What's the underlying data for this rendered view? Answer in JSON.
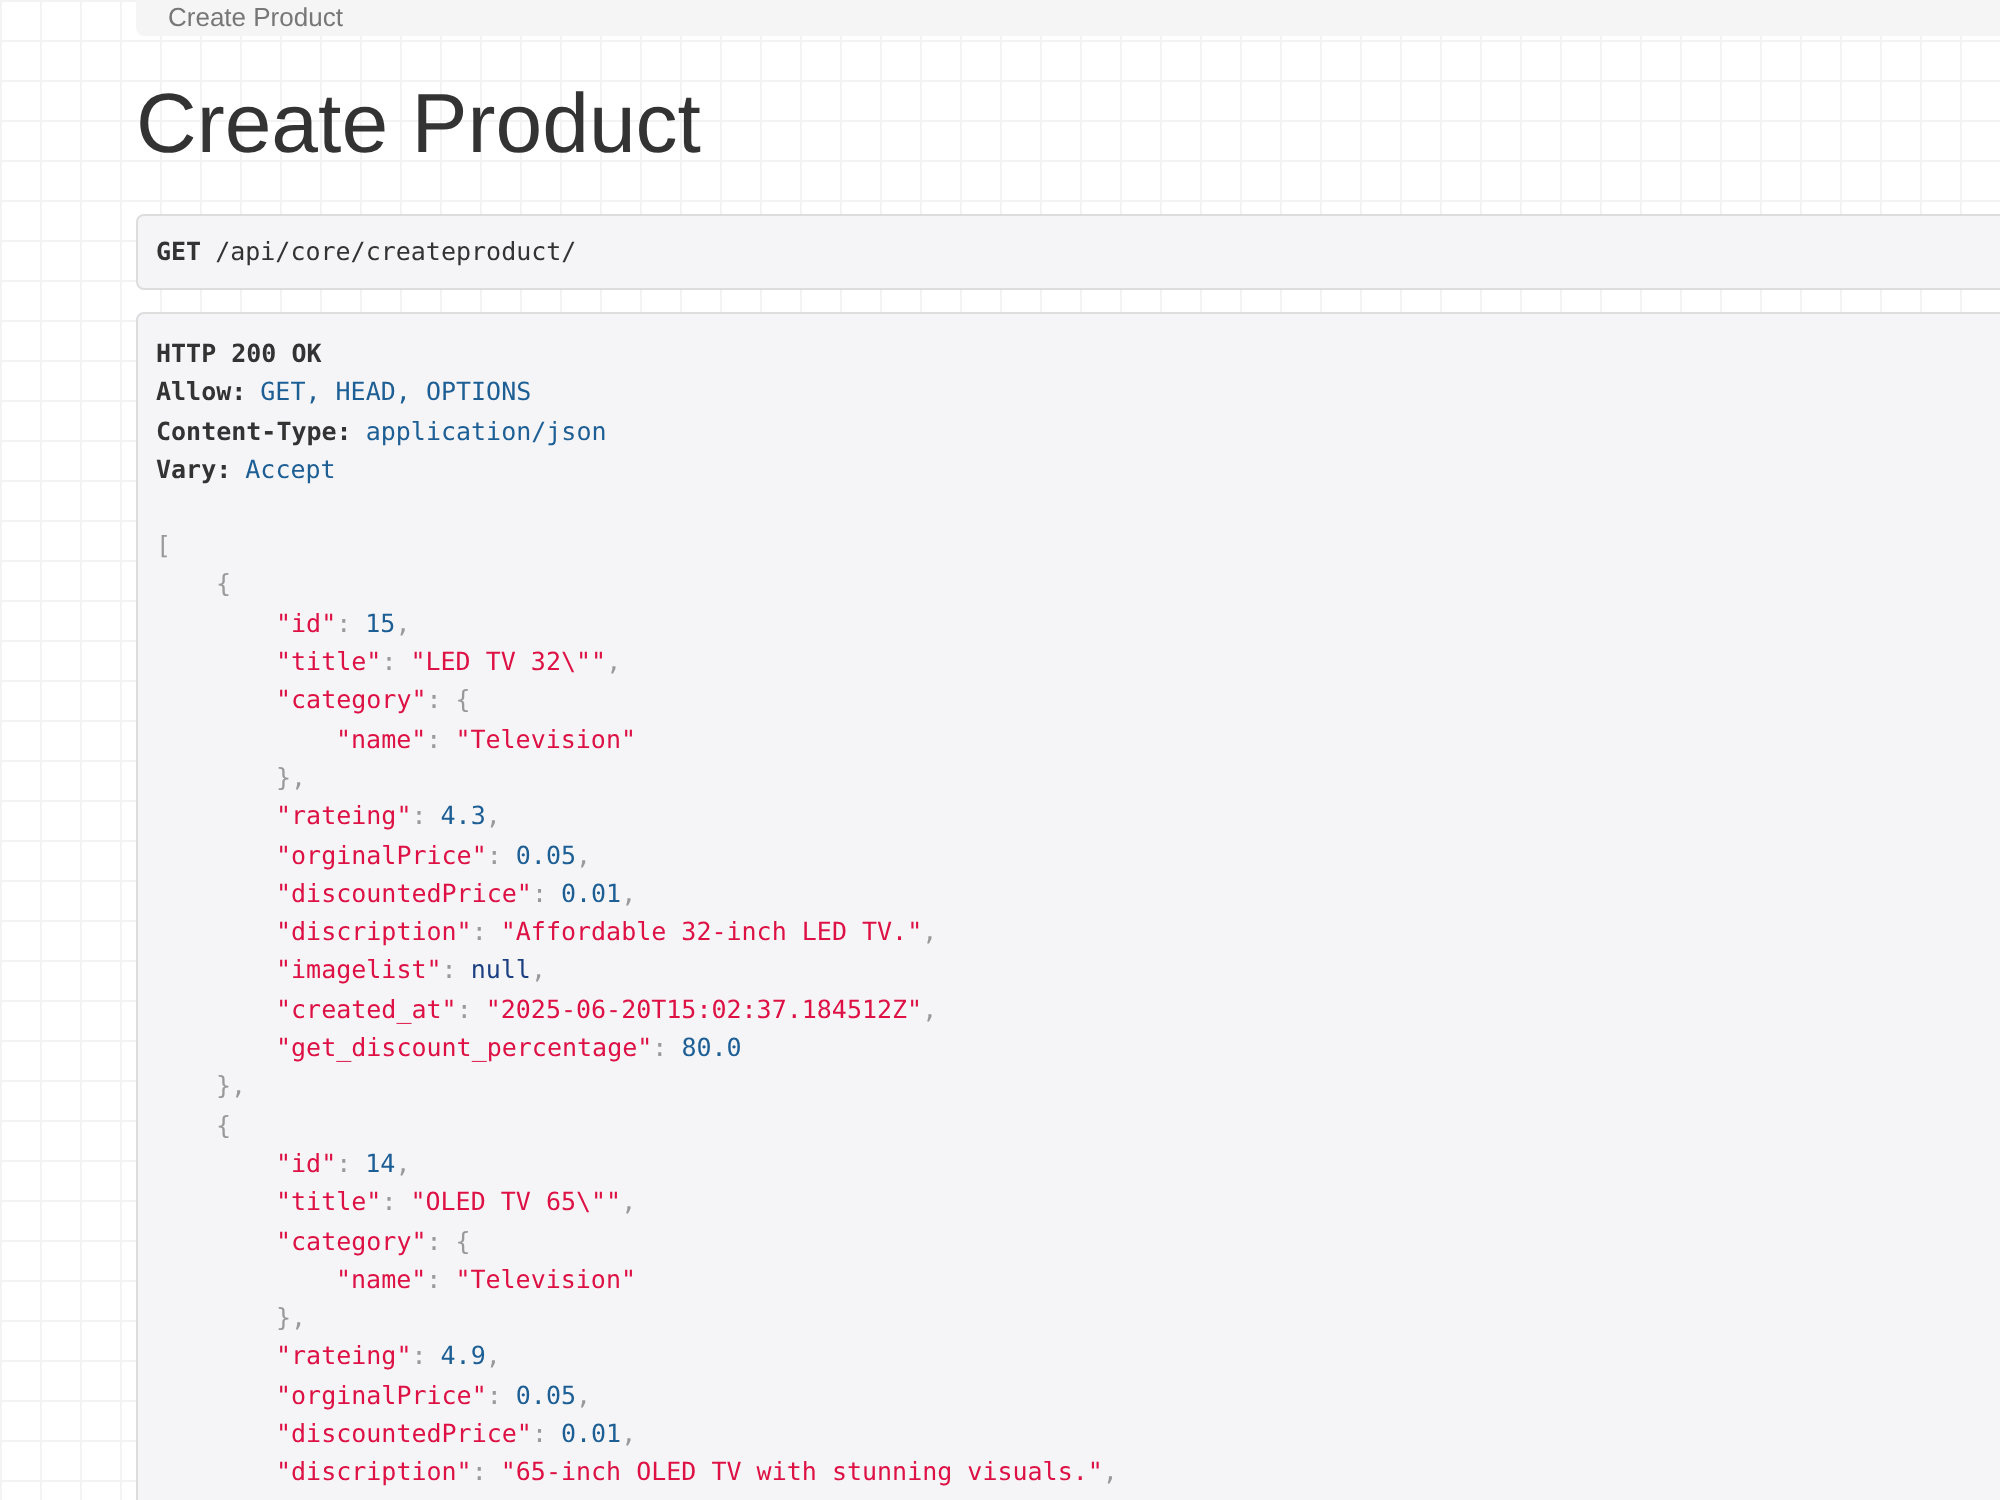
{
  "breadcrumb": {
    "items": [
      "Create Product"
    ]
  },
  "title": "Create Product",
  "request": {
    "method": "GET",
    "url": "/api/core/createproduct/"
  },
  "response": {
    "status": "HTTP 200 OK",
    "headers": [
      {
        "name": "Allow:",
        "value": "GET, HEAD, OPTIONS"
      },
      {
        "name": "Content-Type:",
        "value": "application/json"
      },
      {
        "name": "Vary:",
        "value": "Accept"
      }
    ],
    "body": {
      "open": "[",
      "objects": [
        {
          "open": "{",
          "close": "},",
          "fields": [
            {
              "key": "\"id\"",
              "colon": ":",
              "value": "15",
              "comma": ",",
              "kind": "number"
            },
            {
              "key": "\"title\"",
              "colon": ":",
              "value": "\"LED TV 32\\\"\"",
              "comma": ",",
              "kind": "string"
            },
            {
              "key": "\"category\"",
              "colon": ":",
              "kind": "object",
              "open": "{",
              "close": "},",
              "children": [
                {
                  "key": "\"name\"",
                  "colon": ":",
                  "value": "\"Television\"",
                  "kind": "string"
                }
              ]
            },
            {
              "key": "\"rateing\"",
              "colon": ":",
              "value": "4.3",
              "comma": ",",
              "kind": "number"
            },
            {
              "key": "\"orginalPrice\"",
              "colon": ":",
              "value": "0.05",
              "comma": ",",
              "kind": "number"
            },
            {
              "key": "\"discountedPrice\"",
              "colon": ":",
              "value": "0.01",
              "comma": ",",
              "kind": "number"
            },
            {
              "key": "\"discription\"",
              "colon": ":",
              "value": "\"Affordable 32-inch LED TV.\"",
              "comma": ",",
              "kind": "string"
            },
            {
              "key": "\"imagelist\"",
              "colon": ":",
              "value": "null",
              "comma": ",",
              "kind": "null"
            },
            {
              "key": "\"created_at\"",
              "colon": ":",
              "value": "\"2025-06-20T15:02:37.184512Z\"",
              "comma": ",",
              "kind": "string"
            },
            {
              "key": "\"get_discount_percentage\"",
              "colon": ":",
              "value": "80.0",
              "kind": "number"
            }
          ]
        },
        {
          "open": "{",
          "fields": [
            {
              "key": "\"id\"",
              "colon": ":",
              "value": "14",
              "comma": ",",
              "kind": "number"
            },
            {
              "key": "\"title\"",
              "colon": ":",
              "value": "\"OLED TV 65\\\"\"",
              "comma": ",",
              "kind": "string"
            },
            {
              "key": "\"category\"",
              "colon": ":",
              "kind": "object",
              "open": "{",
              "close": "},",
              "children": [
                {
                  "key": "\"name\"",
                  "colon": ":",
                  "value": "\"Television\"",
                  "kind": "string"
                }
              ]
            },
            {
              "key": "\"rateing\"",
              "colon": ":",
              "value": "4.9",
              "comma": ",",
              "kind": "number"
            },
            {
              "key": "\"orginalPrice\"",
              "colon": ":",
              "value": "0.05",
              "comma": ",",
              "kind": "number"
            },
            {
              "key": "\"discountedPrice\"",
              "colon": ":",
              "value": "0.01",
              "comma": ",",
              "kind": "number"
            },
            {
              "key": "\"discription\"",
              "colon": ":",
              "value": "\"65-inch OLED TV with stunning visuals.\"",
              "comma": ",",
              "kind": "string"
            }
          ]
        }
      ]
    }
  }
}
